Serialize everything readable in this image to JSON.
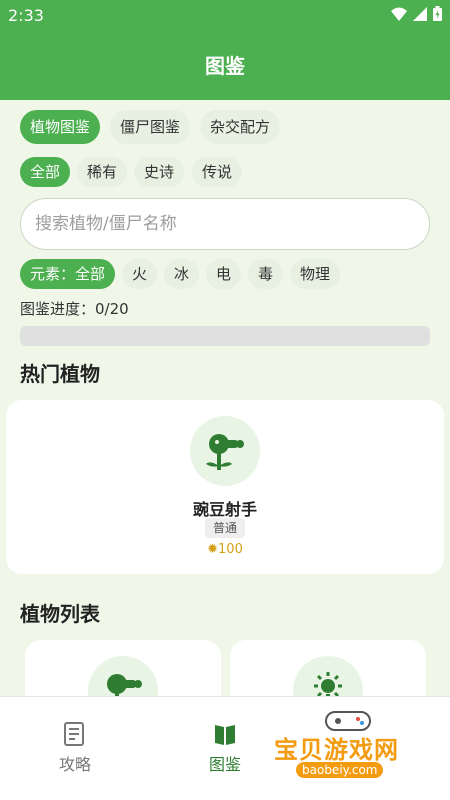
{
  "status": {
    "time": "2:33"
  },
  "app": {
    "title": "图鉴"
  },
  "main_tabs": [
    {
      "label": "植物图鉴",
      "active": true
    },
    {
      "label": "僵尸图鉴",
      "active": false
    },
    {
      "label": "杂交配方",
      "active": false
    }
  ],
  "rarity_filters": [
    {
      "label": "全部",
      "active": true
    },
    {
      "label": "稀有",
      "active": false
    },
    {
      "label": "史诗",
      "active": false
    },
    {
      "label": "传说",
      "active": false
    }
  ],
  "search": {
    "placeholder": "搜索植物/僵尸名称",
    "value": ""
  },
  "element_filters": [
    {
      "label": "元素：全部",
      "active": true
    },
    {
      "label": "火",
      "active": false
    },
    {
      "label": "冰",
      "active": false
    },
    {
      "label": "电",
      "active": false
    },
    {
      "label": "毒",
      "active": false
    },
    {
      "label": "物理",
      "active": false
    }
  ],
  "progress": {
    "label": "图鉴进度：0/20",
    "fraction": 0.0
  },
  "sections": {
    "hot": "热门植物",
    "list": "植物列表"
  },
  "featured": {
    "name": "豌豆射手",
    "rarity": "普通",
    "cost": "100",
    "icon": "peashooter-icon"
  },
  "list_icons": [
    "peashooter-icon",
    "sunflower-icon"
  ],
  "bottom_nav": [
    {
      "label": "攻略",
      "icon": "guide-icon",
      "active": false
    },
    {
      "label": "图鉴",
      "icon": "book-icon",
      "active": true
    }
  ],
  "watermark": {
    "title": "宝贝游戏网",
    "url": "baobeiy.com"
  },
  "colors": {
    "primary": "#4caf50",
    "background": "#f0f7e9",
    "active_nav": "#2e7d32",
    "sun": "#d4a017"
  }
}
